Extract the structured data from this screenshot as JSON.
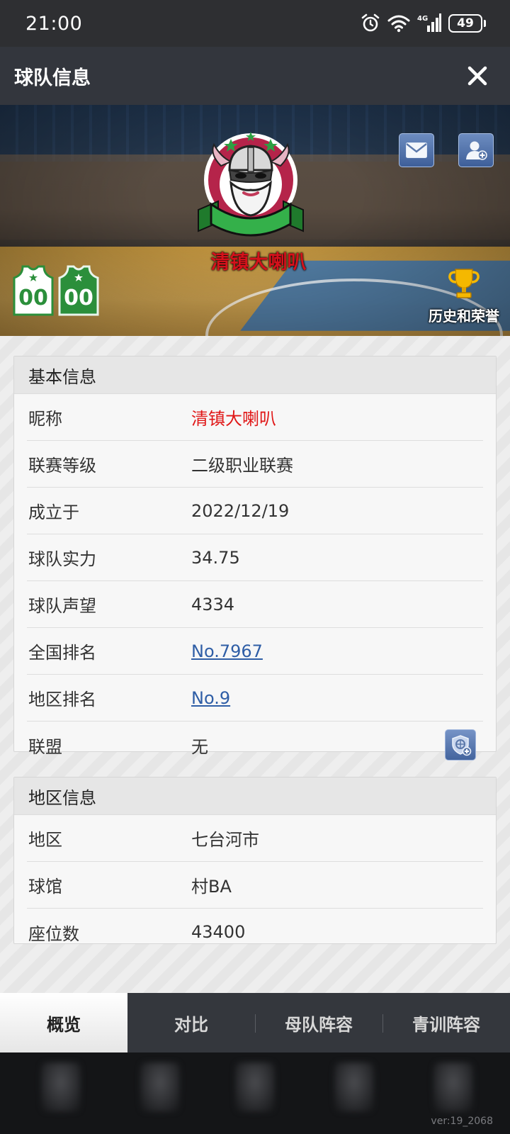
{
  "status_bar": {
    "time": "21:00",
    "network": "4G",
    "battery": "49"
  },
  "header": {
    "title": "球队信息"
  },
  "hero": {
    "team_name": "清镇大喇叭",
    "honor_label": "历史和荣誉",
    "jersey_home_number": "00",
    "jersey_away_number": "00"
  },
  "basic_info": {
    "title": "基本信息",
    "rows": [
      {
        "label": "昵称",
        "value": "清镇大喇叭"
      },
      {
        "label": "联赛等级",
        "value": "二级职业联赛"
      },
      {
        "label": "成立于",
        "value": "2022/12/19"
      },
      {
        "label": "球队实力",
        "value": "34.75"
      },
      {
        "label": "球队声望",
        "value": "4334"
      },
      {
        "label": "全国排名",
        "value": "No.7967"
      },
      {
        "label": "地区排名",
        "value": "No.9"
      },
      {
        "label": "联盟",
        "value": "无"
      }
    ]
  },
  "region_info": {
    "title": "地区信息",
    "rows": [
      {
        "label": "地区",
        "value": "七台河市"
      },
      {
        "label": "球馆",
        "value": "村BA"
      },
      {
        "label": "座位数",
        "value": "43400"
      }
    ]
  },
  "tabs": [
    {
      "label": "概览",
      "active": true
    },
    {
      "label": "对比",
      "active": false
    },
    {
      "label": "母队阵容",
      "active": false
    },
    {
      "label": "青训阵容",
      "active": false
    }
  ],
  "footer": {
    "version": "ver:19_2068"
  },
  "colors": {
    "accent_red": "#e01818",
    "link_blue": "#2f5ea6",
    "header_bg": "#33363d"
  }
}
